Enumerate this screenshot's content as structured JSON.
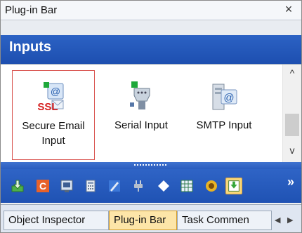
{
  "panel": {
    "title": "Plug-in Bar",
    "close_symbol": "×"
  },
  "section": {
    "title": "Inputs"
  },
  "items": [
    {
      "label_line1": "Secure Email",
      "label_line2": "Input",
      "icon": "secure-email-ssl-icon",
      "selected": true
    },
    {
      "label_line1": "Serial Input",
      "label_line2": "",
      "icon": "serial-port-icon",
      "selected": false
    },
    {
      "label_line1": "SMTP Input",
      "label_line2": "",
      "icon": "smtp-server-icon",
      "selected": false
    }
  ],
  "scrollbar": {
    "up_symbol": "^",
    "down_symbol": "v"
  },
  "toolbar": {
    "buttons": [
      "download-icon",
      "c-icon",
      "monitor-icon",
      "calculator-icon",
      "pen-icon",
      "plug-icon",
      "diamond-icon",
      "grid-icon",
      "power-icon",
      "inbox-download-icon"
    ],
    "more_symbol": "»"
  },
  "tabs": [
    {
      "label": "Object Inspector",
      "active": false
    },
    {
      "label": "Plug-in Bar",
      "active": true
    },
    {
      "label": "Task Commen",
      "active": false
    }
  ],
  "tab_nav": {
    "prev_symbol": "◀",
    "next_symbol": "▶"
  },
  "colors": {
    "accent_blue": "#2c62c4",
    "selection_border": "#d9534f",
    "active_tab": "#fde5a8"
  }
}
